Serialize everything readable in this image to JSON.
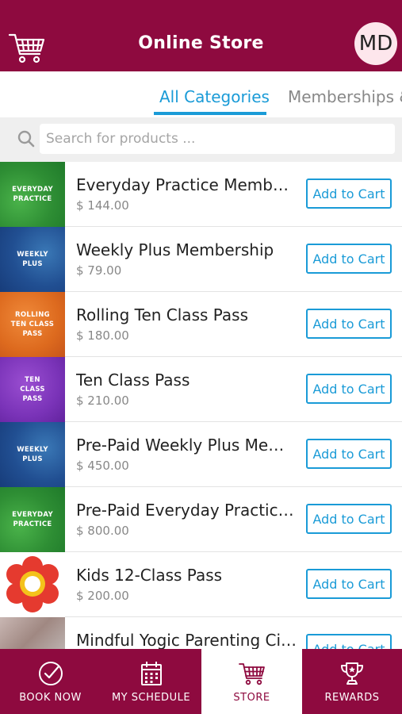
{
  "header": {
    "title": "Online Store",
    "avatar_initials": "MD",
    "cart_icon": "shopping-cart-icon"
  },
  "tabs": [
    {
      "label": "All Categories",
      "active": true
    },
    {
      "label": "Memberships &",
      "active": false
    }
  ],
  "search": {
    "placeholder": "Search for products ...",
    "value": ""
  },
  "products": [
    {
      "name": "Everyday Practice Members...",
      "price": "$ 144.00",
      "thumb_text": "EVERYDAY\nPRACTICE",
      "thumb_color": "green",
      "button": "Add to Cart"
    },
    {
      "name": "Weekly Plus Membership",
      "price": "$ 79.00",
      "thumb_text": "WEEKLY\nPLUS",
      "thumb_color": "blue",
      "button": "Add to Cart"
    },
    {
      "name": "Rolling Ten Class Pass",
      "price": "$ 180.00",
      "thumb_text": "ROLLING\nTEN CLASS\nPASS",
      "thumb_color": "orange",
      "button": "Add to Cart"
    },
    {
      "name": "Ten Class Pass",
      "price": "$ 210.00",
      "thumb_text": "TEN\nCLASS\nPASS",
      "thumb_color": "purple",
      "button": "Add to Cart"
    },
    {
      "name": "Pre-Paid Weekly Plus Memb...",
      "price": "$ 450.00",
      "thumb_text": "WEEKLY\nPLUS",
      "thumb_color": "blue",
      "button": "Add to Cart"
    },
    {
      "name": "Pre-Paid Everyday Practice ...",
      "price": "$ 800.00",
      "thumb_text": "EVERYDAY\nPRACTICE",
      "thumb_color": "green",
      "button": "Add to Cart"
    },
    {
      "name": "Kids 12-Class Pass",
      "price": "$ 200.00",
      "thumb_text": "",
      "thumb_color": "flower",
      "button": "Add to Cart"
    },
    {
      "name": "Mindful Yogic Parenting Circ...",
      "price": "",
      "thumb_text": "",
      "thumb_color": "gray",
      "button": "Add to Cart"
    }
  ],
  "bottom_nav": [
    {
      "label": "BOOK NOW",
      "icon": "check-circle-icon",
      "active": false
    },
    {
      "label": "MY SCHEDULE",
      "icon": "calendar-icon",
      "active": false
    },
    {
      "label": "STORE",
      "icon": "shopping-cart-icon",
      "active": true
    },
    {
      "label": "REWARDS",
      "icon": "trophy-icon",
      "active": false
    }
  ],
  "colors": {
    "brand": "#8e0a3f",
    "accent": "#1a9bd7"
  }
}
